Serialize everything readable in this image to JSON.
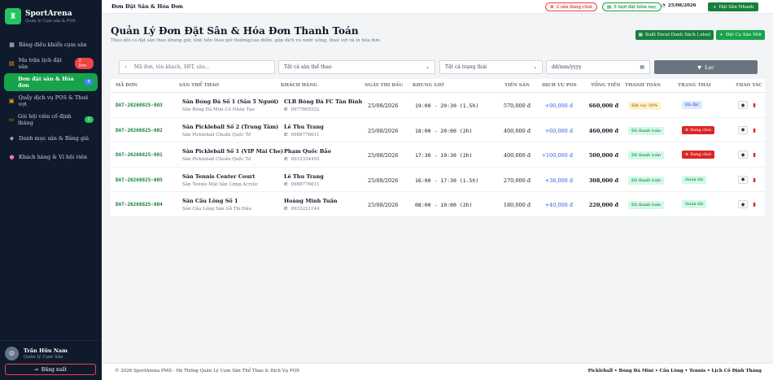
{
  "app": {
    "name": "SportArena",
    "subtitle": "Quản lý Cụm sân & POS"
  },
  "sidebar": {
    "items": [
      {
        "icon": "dashboard-icon",
        "label": "Bảng điều khiển cụm sân"
      },
      {
        "icon": "calendar-icon",
        "label": "Ma trận lịch đặt sân",
        "badge": "2 live"
      },
      {
        "icon": "cart-icon",
        "label": "Đơn đặt sân & Hóa đơn",
        "badge": "5"
      },
      {
        "icon": "shop-icon",
        "label": "Quầy dịch vụ POS & Thuê vợt"
      },
      {
        "icon": "card-icon",
        "label": "Gói hội viên cố định tháng",
        "badge": "2"
      },
      {
        "icon": "layers-icon",
        "label": "Danh mục sân & Bảng giá"
      },
      {
        "icon": "users-icon",
        "label": "Khách hàng & Ví hội viên"
      }
    ],
    "user": {
      "name": "Trần Hữu Nam",
      "role": "Quản lý Cụm Sân"
    },
    "logout_label": "Đăng xuất"
  },
  "topbar": {
    "breadcrumb": "Đơn Đặt Sân & Hóa Đơn",
    "playing_label": "2 sân đang chơi",
    "today_label": "5 lượt đặt hôm nay",
    "date": "25/08/2026",
    "quick_btn": "Đặt Sân Nhanh"
  },
  "header": {
    "title": "Quản Lý Đơn Đặt Sân & Hóa Đơn Thanh Toán",
    "subtitle": "Theo dõi ca đặt sân theo khung giờ, tính tiền theo giờ thường/cao điểm, gộp dịch vụ nước uống, thuê vợt và in hóa đơn.",
    "export_btn": "Xuất Excel Danh Sách (.xlsx)",
    "new_btn": "Đặt Ca Sân Mới"
  },
  "filters": {
    "search_placeholder": "Mã đơn, tên khách, SĐT, sân...",
    "sport_value": "Tất cả sân thể thao",
    "status_value": "Tất cả trạng thái",
    "date_placeholder": "dd/mm/yyyy",
    "filter_btn": "Lọc"
  },
  "table": {
    "columns": [
      "Mã Đơn",
      "Sân Thể Thao",
      "Khách Hàng",
      "Ngày Thi Đấu",
      "Khung Giờ",
      "Tiền Sân",
      "Dịch Vụ POS",
      "Tổng Tiền",
      "Thanh Toán",
      "Trạng Thái",
      "Thao Tác"
    ],
    "rows": [
      {
        "code": "DAT-20260825-003",
        "court": "Sân Bóng Đá Số 1 (Sân 5 Người)",
        "court_sub": "Sân Bóng Đá Mini Cỏ Nhân Tạo",
        "customer": "CLB Bóng Đá FC Tân Bình",
        "phone": "0977665522",
        "date": "25/08/2026",
        "slot": "19:00 - 20:30 (1.5h)",
        "price": "570,000 đ",
        "pos": "+90,000 đ",
        "total": "660,000 đ",
        "payment": "Đặt cọc 50%",
        "pay_style": "yellow",
        "status": "Đã đặt",
        "status_style": "blue"
      },
      {
        "code": "DAT-20260825-002",
        "court": "Sân Pickleball Số 2 (Trung Tâm)",
        "court_sub": "Sân Pickleball Chuẩn Quốc Tế",
        "customer": "Lê Thu Trang",
        "phone": "0988776611",
        "date": "25/08/2026",
        "slot": "18:00 - 20:00 (2h)",
        "price": "400,000 đ",
        "pos": "+60,000 đ",
        "total": "460,000 đ",
        "payment": "Đã thanh toán",
        "pay_style": "green",
        "status": "Đang chơi",
        "status_style": "red"
      },
      {
        "code": "DAT-20260825-001",
        "court": "Sân Pickleball Số 1 (VIP Mái Che)",
        "court_sub": "Sân Pickleball Chuẩn Quốc Tế",
        "customer": "Phạm Quốc Bảo",
        "phone": "0912334455",
        "date": "25/08/2026",
        "slot": "17:30 - 19:30 (2h)",
        "price": "400,000 đ",
        "pos": "+100,000 đ",
        "total": "500,000 đ",
        "payment": "Đã thanh toán",
        "pay_style": "green",
        "status": "Đang chơi",
        "status_style": "red"
      },
      {
        "code": "DAT-20260825-005",
        "court": "Sân Tennis Center Court",
        "court_sub": "Sân Tennis Mặt Sân Cứng Acrylic",
        "customer": "Lê Thu Trang",
        "phone": "0988776611",
        "date": "25/08/2026",
        "slot": "16:00 - 17:30 (1.5h)",
        "price": "270,000 đ",
        "pos": "+38,000 đ",
        "total": "308,000 đ",
        "payment": "Đã thanh toán",
        "pay_style": "green",
        "status": "Hoàn tất",
        "status_style": "green"
      },
      {
        "code": "DAT-20260825-004",
        "court": "Sân Cầu Lông Số 1",
        "court_sub": "Sân Cầu Lông Sàn Gỗ Thi Đấu",
        "customer": "Hoàng Minh Tuấn",
        "phone": "0933221144",
        "date": "25/08/2026",
        "slot": "08:00 - 10:00 (2h)",
        "price": "180,000 đ",
        "pos": "+40,000 đ",
        "total": "220,000 đ",
        "payment": "Đã thanh toán",
        "pay_style": "green",
        "status": "Hoàn tất",
        "status_style": "green"
      }
    ]
  },
  "footer": {
    "left": "© 2026 SportArena PMS - Hệ Thống Quản Lý Cụm Sân Thể Thao & Dịch Vụ POS",
    "right": "Pickleball • Bóng Đá Mini • Cầu Lông • Tennis • Lịch Cố Định Tháng"
  }
}
